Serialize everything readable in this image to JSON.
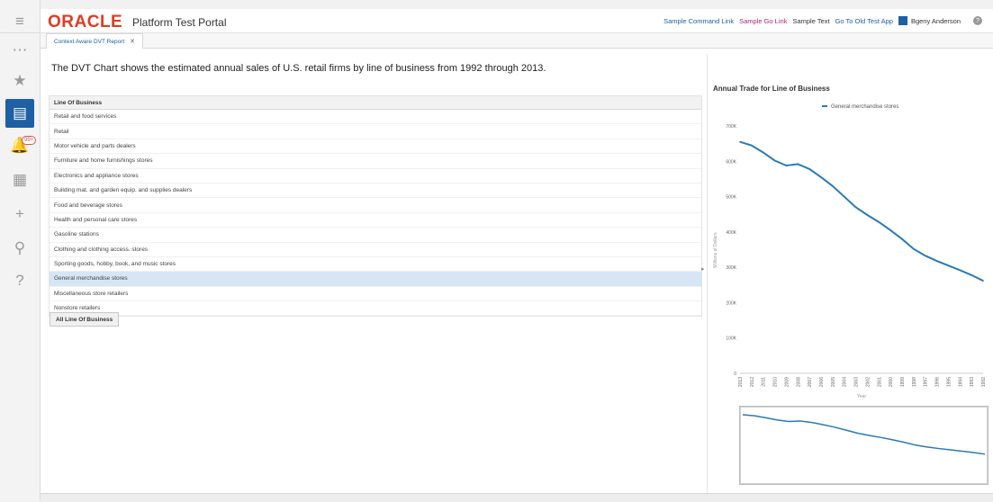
{
  "header": {
    "logo": "ORACLE",
    "portal_name": "Platform Test Portal",
    "links": {
      "command_link": "Sample Command Link",
      "go_link": "Sample Go Link",
      "sample_text": "Sample Text",
      "old_test_app": "Go To Old Test App"
    },
    "user_name": "Bgeny Anderson"
  },
  "tab": {
    "label": "Context Aware DVT Report"
  },
  "intro_text": "The DVT Chart shows the estimated annual sales of U.S. retail firms by line of business from 1992 through 2013.",
  "list": {
    "header": "Line Of Business",
    "items": [
      "Retail and food services",
      "Retail",
      "Motor vehicle and parts dealers",
      "Furniture and home furnishings stores",
      "Electronics and appliance stores",
      "Building mat. and garden equip. and supplies dealers",
      "Food and beverage stores",
      "Health and personal care stores",
      "Gasoline stations",
      "Clothing and clothing access. stores",
      "Sporting goods, hobby, book, and music stores",
      "General merchandise stores",
      "Miscellaneous store retailers",
      "Nonstore retailers"
    ],
    "selected_index": 11,
    "all_button": "All Line Of Business"
  },
  "rail": {
    "badge": "99+"
  },
  "chart_data": {
    "type": "line",
    "title": "Annual Trade for Line of Business",
    "xlabel": "Year",
    "ylabel": "Millions of Dollars",
    "ylim": [
      0,
      700000
    ],
    "yticks": [
      "0",
      "100K",
      "200K",
      "300K",
      "400K",
      "500K",
      "600K",
      "700K"
    ],
    "legend_position": "top",
    "series": [
      {
        "name": "General merchandise stores",
        "color": "#2a7ab8",
        "x": [
          "2013",
          "2012",
          "2011",
          "2010",
          "2009",
          "2008",
          "2007",
          "2006",
          "2005",
          "2004",
          "2003",
          "2002",
          "2001",
          "2000",
          "1999",
          "1998",
          "1997",
          "1996",
          "1995",
          "1994",
          "1993",
          "1992"
        ],
        "values": [
          655000,
          645000,
          625000,
          602000,
          588000,
          592000,
          578000,
          555000,
          530000,
          500000,
          470000,
          448000,
          428000,
          405000,
          380000,
          352000,
          333000,
          318000,
          305000,
          292000,
          278000,
          262000
        ]
      }
    ]
  }
}
